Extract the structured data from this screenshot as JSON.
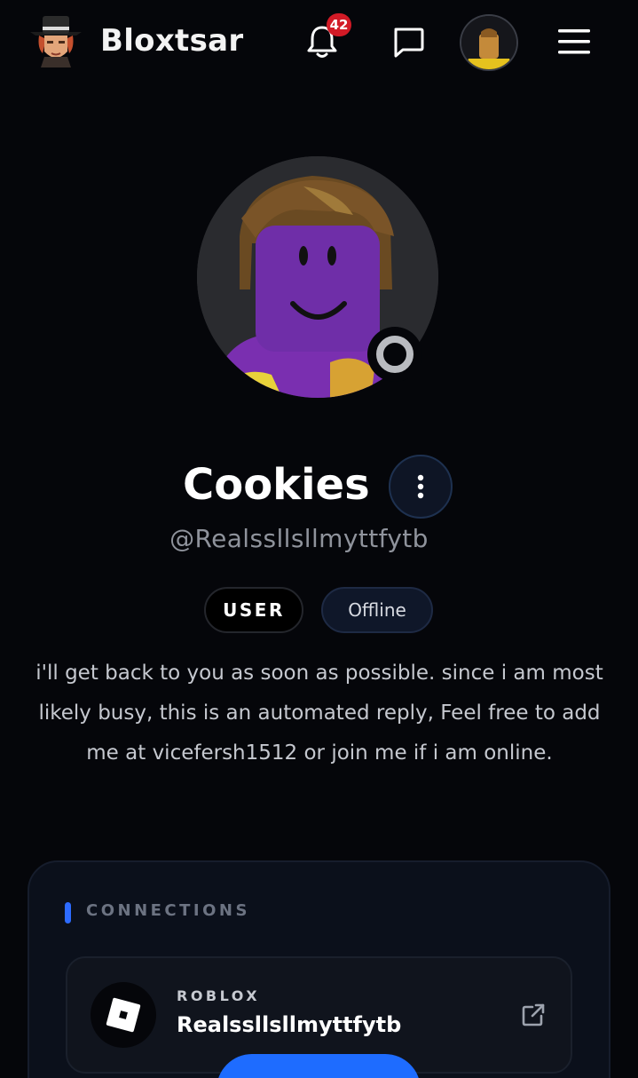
{
  "header": {
    "brand": "Bloxtsar",
    "notification_count": "42"
  },
  "profile": {
    "display_name": "Cookies",
    "username": "@Realssllsllmyttfytb",
    "role_badge": "USER",
    "status": "Offline",
    "bio": "i'll get back to you as soon as possible. since i am most likely busy, this is an automated reply, Feel free to add me at vicefersh1512 or join me if i am online."
  },
  "connections": {
    "title": "CONNECTIONS",
    "items": [
      {
        "platform": "ROBLOX",
        "handle": "Realssllsllmyttfytb",
        "icon": "roblox-logo-icon"
      }
    ]
  },
  "colors": {
    "background": "#05060a",
    "accent": "#2d6bff",
    "badge": "#d21a26"
  }
}
